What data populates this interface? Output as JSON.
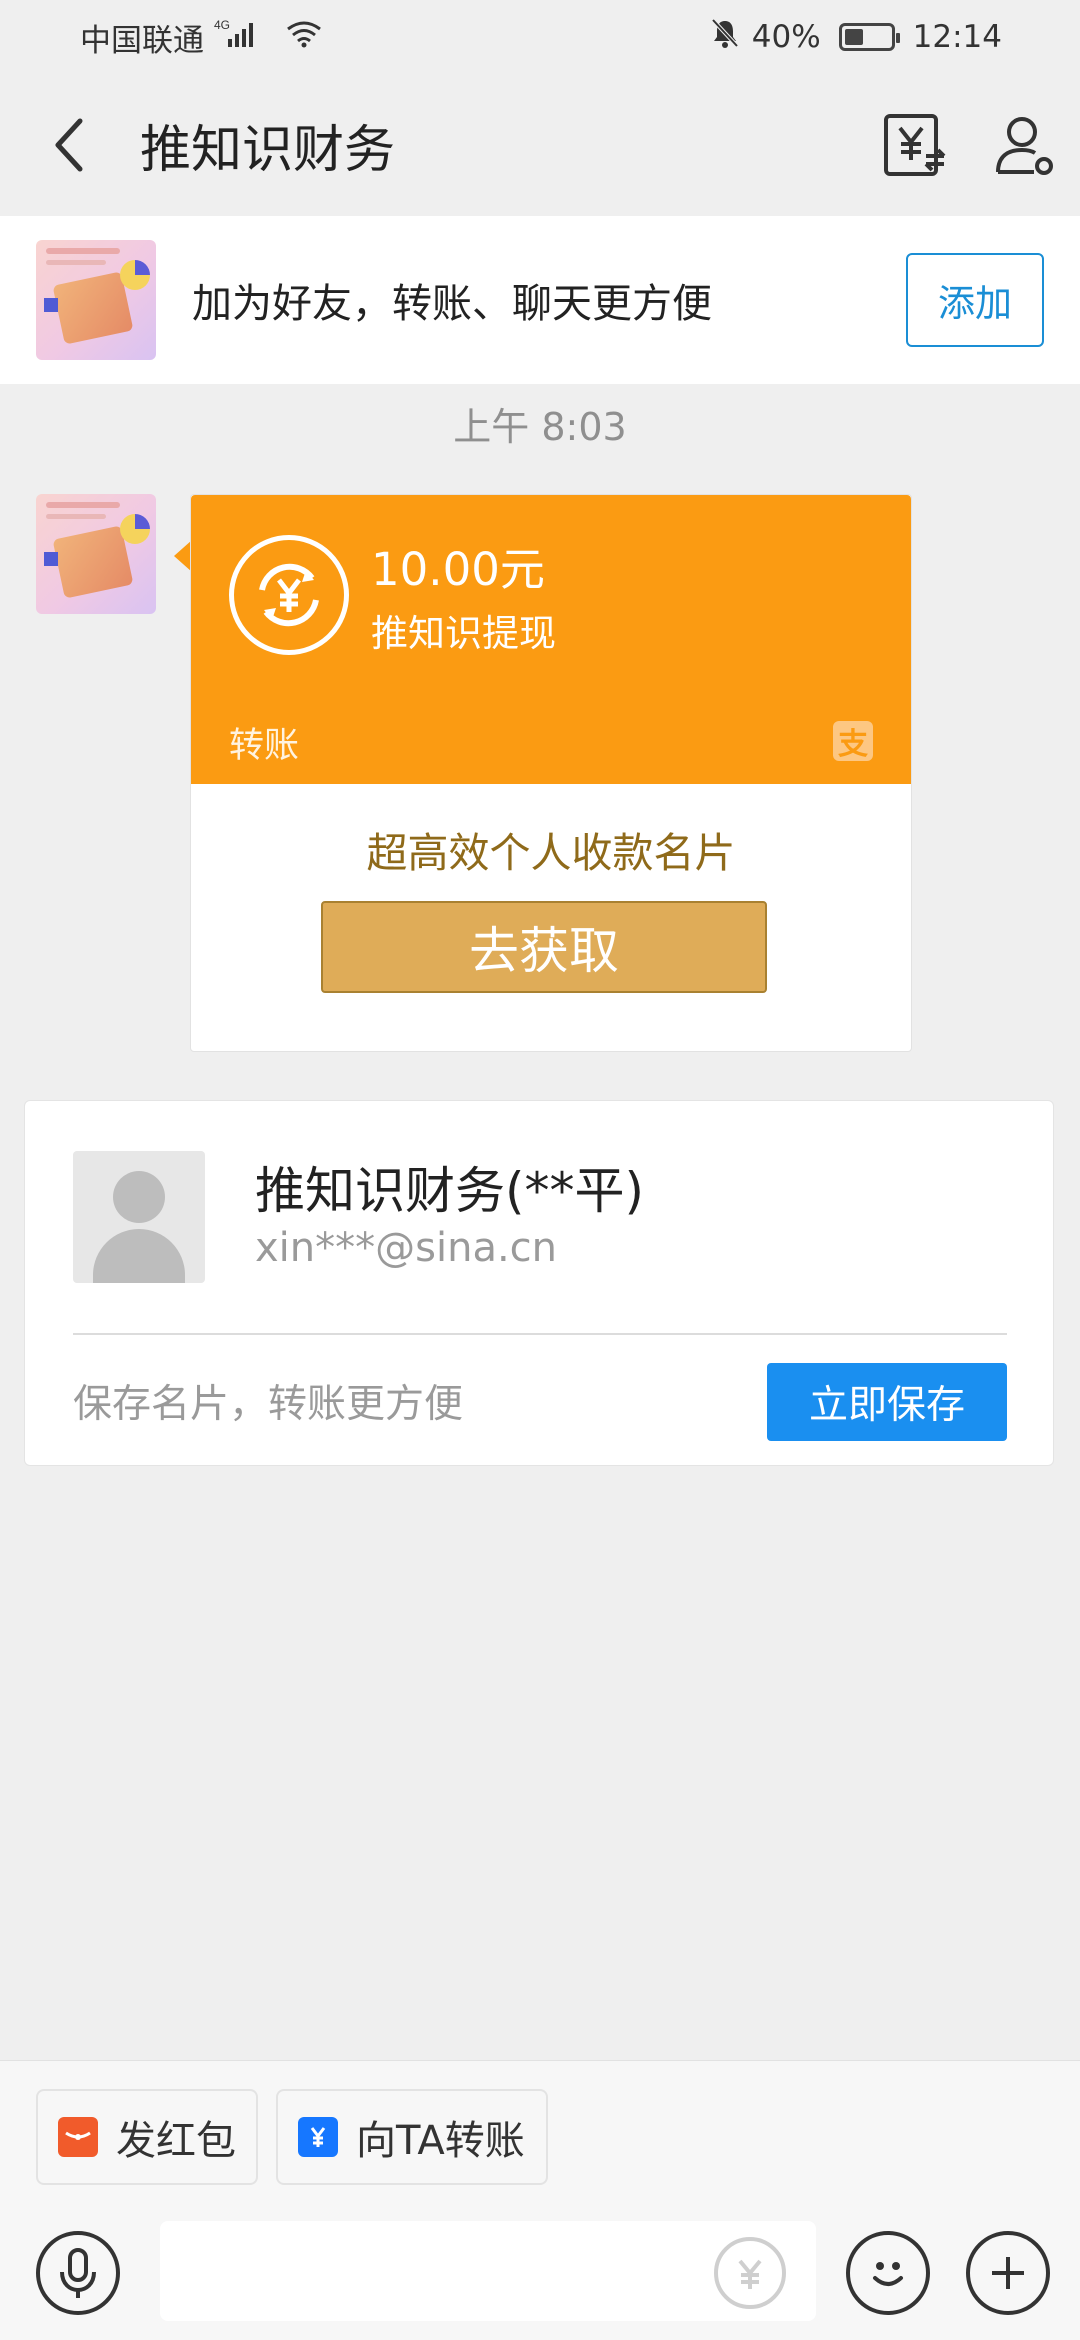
{
  "status_bar": {
    "carrier": "中国联通",
    "network": "4G",
    "battery": "40%",
    "time": "12:14"
  },
  "nav": {
    "title": "推知识财务"
  },
  "friend_banner": {
    "text": "加为好友，转账、聊天更方便",
    "add_label": "添加"
  },
  "chat": {
    "time": "上午 8:03",
    "transfer": {
      "amount": "10.00元",
      "description": "推知识提现",
      "type": "转账",
      "alipay_glyph": "支"
    },
    "promo": "超高效个人收款名片",
    "get_label": "去获取"
  },
  "contact_card": {
    "name": "推知识财务(**平)",
    "email": "xin***@sina.cn",
    "save_hint": "保存名片，转账更方便",
    "save_label": "立即保存"
  },
  "bottom_bar": {
    "red_packet_label": "发红包",
    "transfer_label": "向TA转账"
  }
}
